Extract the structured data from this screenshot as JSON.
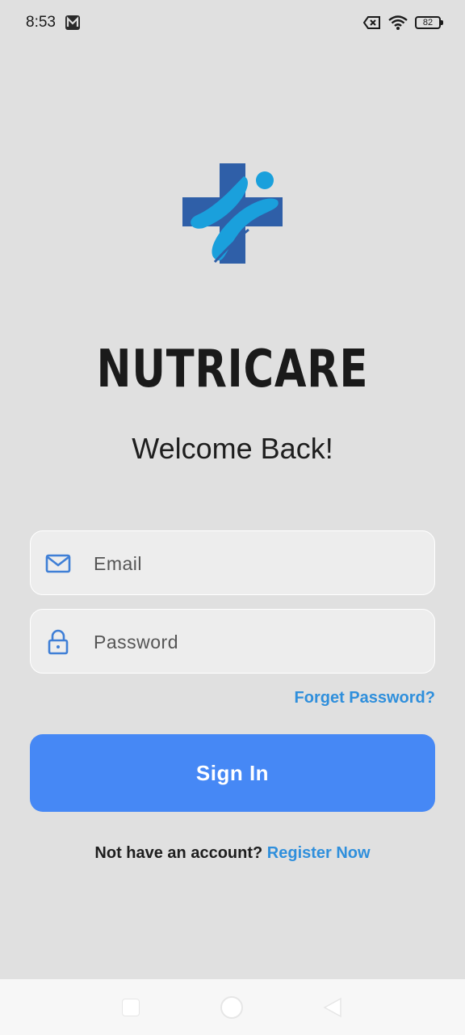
{
  "status_bar": {
    "time": "8:53",
    "battery_level": "82",
    "icons": [
      "notification-m-icon",
      "no-sim-icon",
      "wifi-icon",
      "battery-icon"
    ]
  },
  "app": {
    "brand_name": "NUTRICARE",
    "welcome": "Welcome Back!",
    "logo": "medical-cross-people-logo"
  },
  "form": {
    "email_placeholder": "Email",
    "password_placeholder": "Password",
    "forgot_label": "Forget Password?",
    "signin_label": "Sign In"
  },
  "footer": {
    "question": "Not have an account?",
    "register_label": "Register Now"
  },
  "colors": {
    "background": "#e0e0e0",
    "accent": "#4688f5",
    "link": "#2f8fdc",
    "logo_dark": "#2f5fa8",
    "logo_light": "#1aa0dc"
  }
}
